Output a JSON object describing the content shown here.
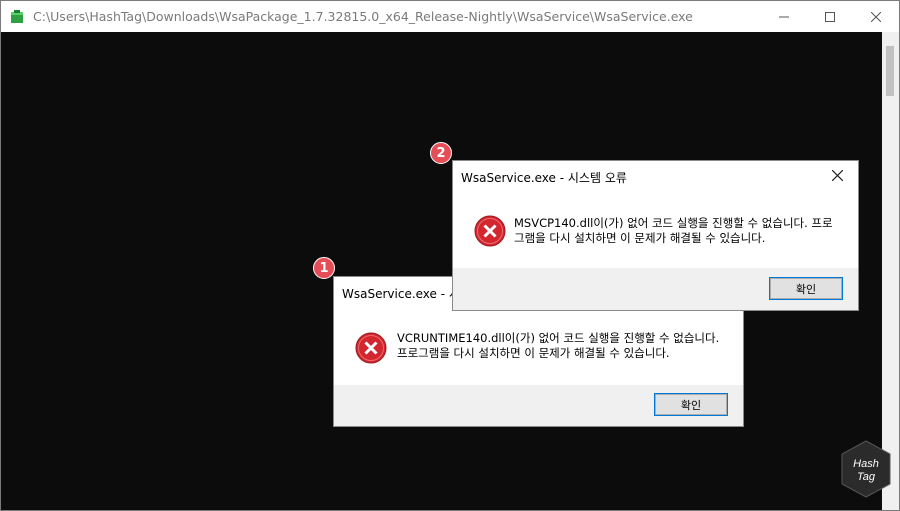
{
  "window": {
    "title": "C:\\Users\\HashTag\\Downloads\\WsaPackage_1.7.32815.0_x64_Release-Nightly\\WsaService\\WsaService.exe",
    "minimize_icon": "minimize-icon",
    "maximize_icon": "maximize-icon",
    "close_icon": "close-icon",
    "app_icon": "green-cube-icon"
  },
  "dialogs": [
    {
      "badge": "1",
      "title": "WsaService.exe - 시스",
      "message_line1": "VCRUNTIME140.dll이(가) 없어 코드 실행을 진행할 수 없습니다.",
      "message_line2": "프로그램을 다시 설치하면 이 문제가 해결될 수 있습니다.",
      "ok_label": "확인",
      "icon": "error-icon"
    },
    {
      "badge": "2",
      "title": "WsaService.exe - 시스템 오류",
      "message_line1": "MSVCP140.dll이(가) 없어 코드 실행을 진행할 수 없습니다. 프로",
      "message_line2": "그램을 다시 설치하면 이 문제가 해결될 수 있습니다.",
      "ok_label": "확인",
      "icon": "error-icon"
    }
  ],
  "watermark": {
    "line1": "Hash",
    "line2": "Tag"
  },
  "colors": {
    "console_bg": "#0c0c0c",
    "badge": "#e54e57",
    "error_red": "#d3262e",
    "ok_border": "#0078d7"
  }
}
